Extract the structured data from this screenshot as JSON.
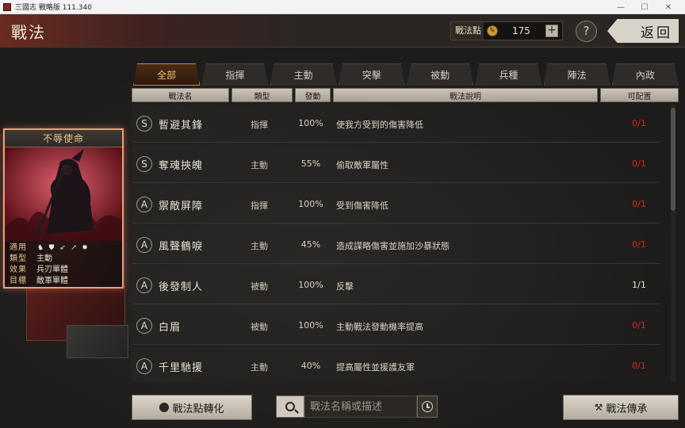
{
  "window": {
    "title": "三國志 戰略版 111.340",
    "controls": [
      "—",
      "☐",
      "✕"
    ]
  },
  "header": {
    "title": "戰法",
    "points_label": "戰法點",
    "points_value": "175",
    "plus_label": "+",
    "help_label": "?",
    "back_label": "返回"
  },
  "tabs": [
    {
      "label": "全部",
      "active": true
    },
    {
      "label": "指揮",
      "active": false
    },
    {
      "label": "主動",
      "active": false
    },
    {
      "label": "突擊",
      "active": false
    },
    {
      "label": "被動",
      "active": false
    },
    {
      "label": "兵種",
      "active": false
    },
    {
      "label": "陣法",
      "active": false
    },
    {
      "label": "內政",
      "active": false
    }
  ],
  "columns": [
    "戰法名",
    "類型",
    "發動",
    "戰法說明",
    "可配置"
  ],
  "rows": [
    {
      "grade": "S",
      "name": "暫避其鋒",
      "type": "指揮",
      "rate": "100%",
      "desc": "使我方受到的傷害降低",
      "count": "0/1",
      "count_color": "red"
    },
    {
      "grade": "S",
      "name": "奪魂挾魄",
      "type": "主動",
      "rate": "55%",
      "desc": "偷取敵軍屬性",
      "count": "0/1",
      "count_color": "red"
    },
    {
      "grade": "A",
      "name": "禦敵屏障",
      "type": "指揮",
      "rate": "100%",
      "desc": "受到傷害降低",
      "count": "0/1",
      "count_color": "red"
    },
    {
      "grade": "A",
      "name": "風聲鶴唳",
      "type": "主動",
      "rate": "45%",
      "desc": "造成謀略傷害並施加沙暴狀態",
      "count": "0/1",
      "count_color": "red"
    },
    {
      "grade": "A",
      "name": "後發制人",
      "type": "被動",
      "rate": "100%",
      "desc": "反擊",
      "count": "1/1",
      "count_color": "white"
    },
    {
      "grade": "A",
      "name": "白眉",
      "type": "被動",
      "rate": "100%",
      "desc": "主動戰法發動機率提高",
      "count": "0/1",
      "count_color": "red"
    },
    {
      "grade": "A",
      "name": "千里馳援",
      "type": "主動",
      "rate": "40%",
      "desc": "提高屬性並援護友軍",
      "count": "0/1",
      "count_color": "red"
    }
  ],
  "card": {
    "title": "不辱使命",
    "labels": {
      "troops": "適用",
      "type": "類型",
      "effect": "效果",
      "target": "目標"
    },
    "type": "主動",
    "effect": "兵刃單體",
    "target": "敵軍單體",
    "troop_icons": [
      "cavalry-icon",
      "shield-icon",
      "archer-icon",
      "spear-icon",
      "siege-icon"
    ]
  },
  "footer": {
    "convert_label": "戰法點轉化",
    "search_placeholder": "戰法名稱或描述",
    "inherit_label": "戰法傳承"
  },
  "colors": {
    "accent": "#d08a2e",
    "card_border": "#e8a07a",
    "count_red": "#d8261e"
  }
}
